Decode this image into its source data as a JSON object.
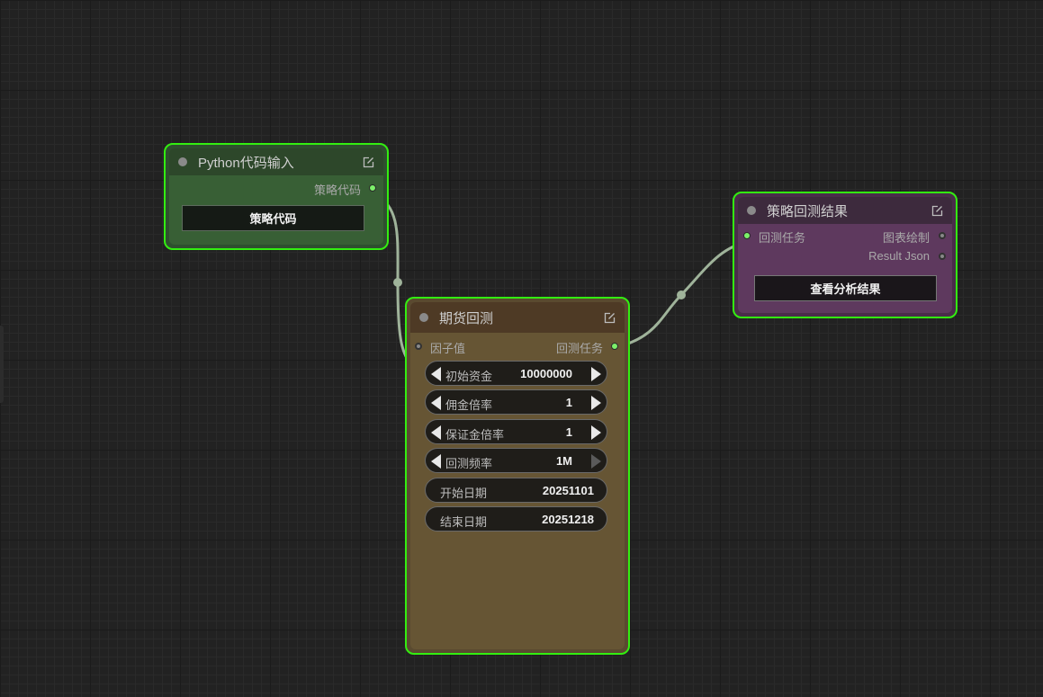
{
  "nodes": {
    "python_input": {
      "title": "Python代码输入",
      "output_label": "策略代码",
      "button_label": "策略代码"
    },
    "futures_backtest": {
      "title": "期货回测",
      "input_label": "因子值",
      "output_label": "回测任务",
      "widgets": [
        {
          "label": "初始资金",
          "value": "10000000"
        },
        {
          "label": "佣金倍率",
          "value": "1"
        },
        {
          "label": "保证金倍率",
          "value": "1"
        },
        {
          "label": "回测频率",
          "value": "1M"
        },
        {
          "label": "开始日期",
          "value": "20251101"
        },
        {
          "label": "结束日期",
          "value": "20251218"
        }
      ]
    },
    "backtest_result": {
      "title": "策略回测结果",
      "input_label": "回测任务",
      "outputs": [
        "图表绘制",
        "Result Json"
      ],
      "button_label": "查看分析结果"
    }
  },
  "colors": {
    "canvas_bg": "#222222",
    "selection_outline": "#33ee11",
    "link": "#9fb39a",
    "python_node": "#385f35",
    "futures_node": "#665534",
    "result_node": "#5e395e"
  }
}
